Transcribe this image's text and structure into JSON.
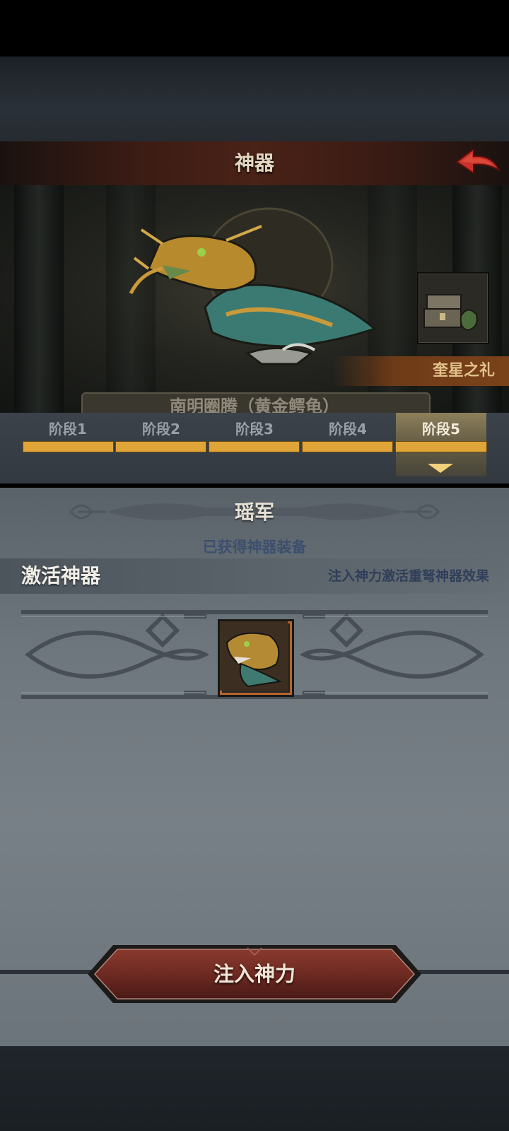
{
  "header": {
    "title": "神器",
    "back_icon": "back-arrow-icon"
  },
  "showcase": {
    "artifact_name": "南明圈腾（黄金鳄龟）",
    "reward_label": "奎星之礼",
    "reward_icon": "treasure-chest-icon"
  },
  "stages": {
    "tabs": [
      "阶段1",
      "阶段2",
      "阶段3",
      "阶段4",
      "阶段5"
    ],
    "selected": 4,
    "progress_color": "#e0a538"
  },
  "detail": {
    "skill_title": "瑶军",
    "obtained_text": "已获得神器装备",
    "activate_title": "激活神器",
    "activate_desc": "注入神力激活重弩神器效果"
  },
  "action": {
    "inject_label": "注入神力",
    "accent_color": "#7a2e25"
  }
}
